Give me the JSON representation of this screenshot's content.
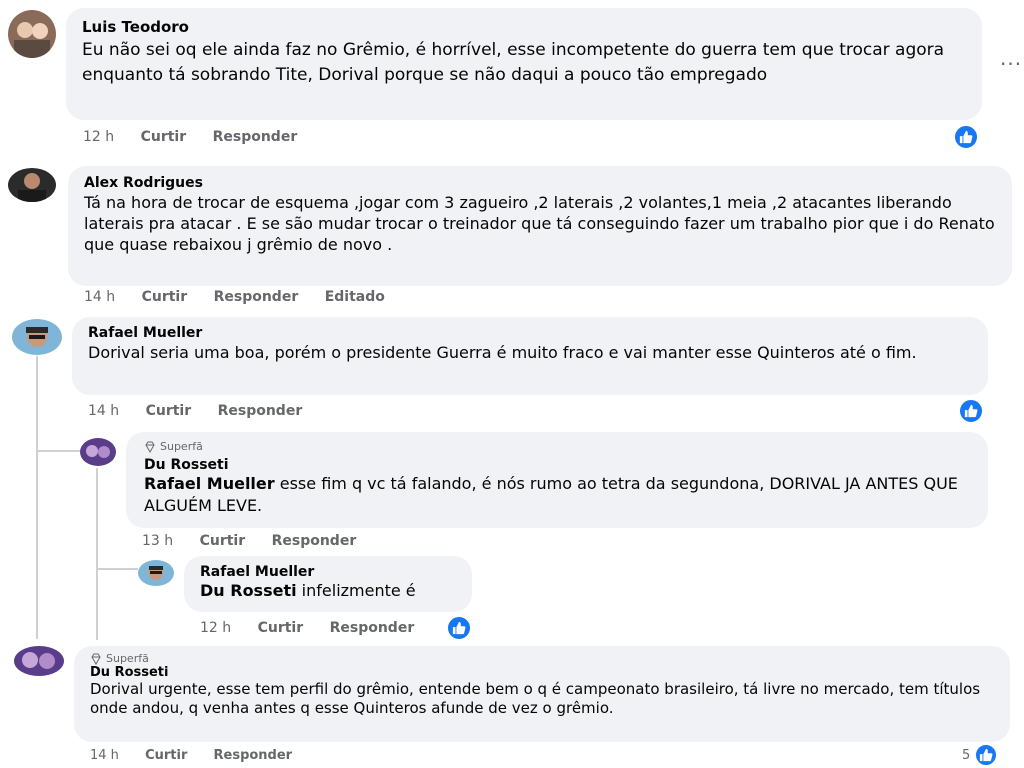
{
  "actions": {
    "like": "Curtir",
    "reply": "Responder",
    "edited": "Editado",
    "more": "..."
  },
  "comments": [
    {
      "name": "Luis Teodoro",
      "text": "Eu não sei oq ele ainda faz no Grêmio, é horrível, esse incompetente do guerra tem que trocar agora enquanto tá sobrando Tite, Dorival porque se não daqui a pouco tão empregado",
      "time": "12 h"
    },
    {
      "name": "Alex Rodrigues",
      "text": "Tá na hora de trocar de esquema ,jogar com 3 zagueiro ,2 laterais ,2 volantes,1 meia ,2 atacantes liberando laterais pra atacar . E se são mudar trocar o treinador que tá conseguindo fazer um trabalho pior que i do Renato que quase rebaixou j grêmio de novo .",
      "time": "14 h"
    },
    {
      "name": "Rafael Mueller",
      "text": "Dorival seria uma boa, porém o presidente Guerra é muito fraco e vai manter esse Quinteros até o fim.",
      "time": "14 h"
    },
    {
      "badge": "Superfã",
      "name": "Du Rosseti",
      "mention": "Rafael Mueller",
      "text": " esse fim q vc tá falando, é nós rumo ao tetra da segundona, DORIVAL JA ANTES QUE ALGUÉM LEVE.",
      "time": "13 h"
    },
    {
      "name": "Rafael Mueller",
      "mention": "Du Rosseti",
      "text": " infelizmente é",
      "time": "12 h"
    },
    {
      "badge": "Superfã",
      "name": "Du Rosseti",
      "text": "Dorival urgente, esse tem perfil do grêmio, entende bem o q é campeonato brasileiro, tá livre no mercado, tem títulos onde andou, q venha antes q esse Quinteros afunde de vez o grêmio.",
      "time": "14 h",
      "reaction_count": "5"
    }
  ],
  "colors": {
    "bubble": "#f0f2f5",
    "like_blue": "#1877f2",
    "meta_gray": "#65676b"
  }
}
